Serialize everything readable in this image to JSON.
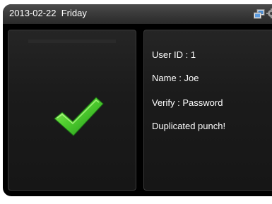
{
  "status_bar": {
    "date": "2013-02-22",
    "day": "Friday",
    "icons": [
      "network-icon",
      "gear-icon"
    ]
  },
  "result": {
    "icon": "check-icon",
    "accent_color": "#3fbf2c"
  },
  "info": {
    "user_id": "User ID : 1",
    "name": "Name : Joe",
    "verify": "Verify : Password",
    "message": "Duplicated punch!"
  }
}
